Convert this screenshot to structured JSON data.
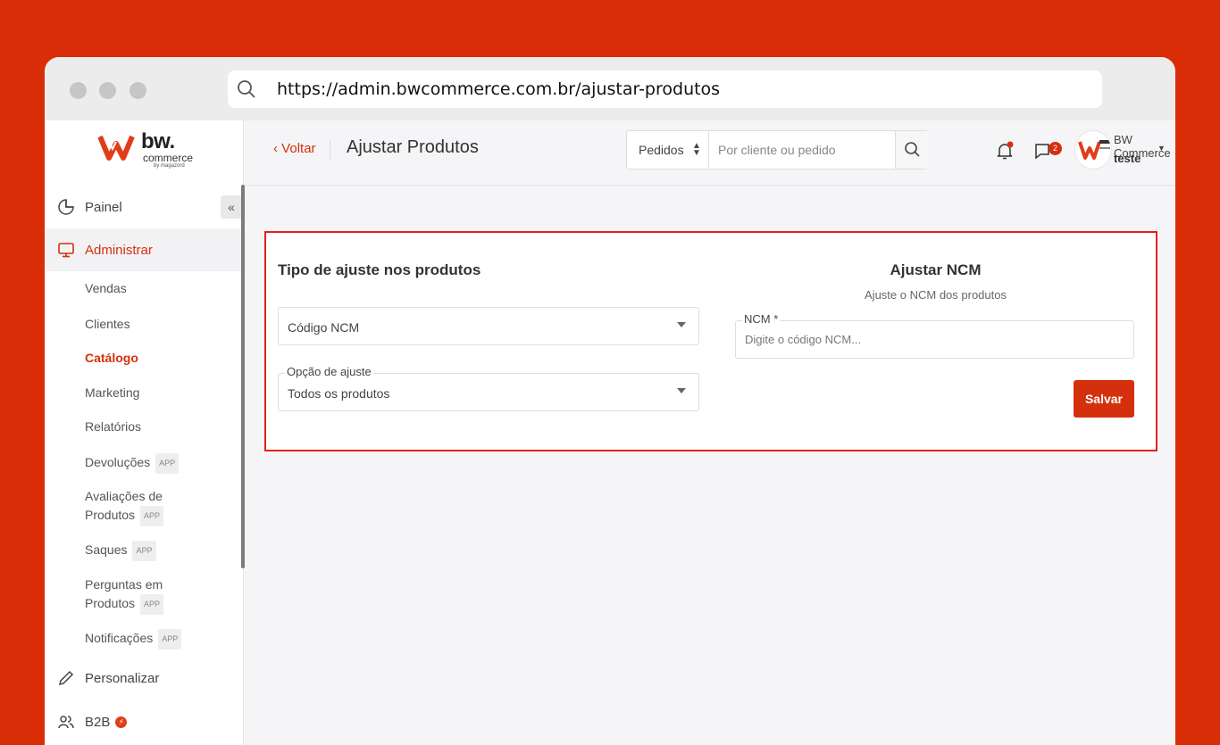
{
  "browser": {
    "url": "https://admin.bwcommerce.com.br/ajustar-produtos"
  },
  "logo": {
    "brand": "bw.",
    "sub": "commerce",
    "by": "by magazord",
    "accent_color": "#e23c18"
  },
  "sidebar": {
    "main_items": [
      {
        "label": "Painel",
        "icon": "pie-chart-icon"
      },
      {
        "label": "Administrar",
        "icon": "monitor-icon"
      },
      {
        "label": "Personalizar",
        "icon": "pencil-icon"
      },
      {
        "label": "B2B",
        "icon": "users-icon"
      }
    ],
    "sub_items": [
      {
        "label": "Vendas"
      },
      {
        "label": "Clientes"
      },
      {
        "label": "Catálogo"
      },
      {
        "label": "Marketing"
      },
      {
        "label": "Relatórios"
      },
      {
        "label": "Devoluções",
        "badge": "APP"
      },
      {
        "label": "Avaliações de",
        "label2": "Produtos",
        "badge": "APP"
      },
      {
        "label": "Saques",
        "badge": "APP"
      },
      {
        "label": "Perguntas em",
        "label2": "Produtos",
        "badge": "APP"
      },
      {
        "label": "Notificações",
        "badge": "APP"
      }
    ],
    "collapse_glyph": "«"
  },
  "header": {
    "back_label": "Voltar",
    "title": "Ajustar Produtos",
    "search_type": "Pedidos",
    "search_placeholder": "Por cliente ou pedido",
    "chat_count": "2",
    "user_name": "BW Commerce",
    "user_role": "teste"
  },
  "card": {
    "left_title": "Tipo de ajuste nos produtos",
    "adjust_type_value": "Código NCM",
    "option_label": "Opção de ajuste",
    "option_value": "Todos os produtos",
    "right_title": "Ajustar NCM",
    "right_subtitle": "Ajuste o NCM dos produtos",
    "ncm_label": "NCM *",
    "ncm_placeholder": "Digite o código NCM...",
    "save_label": "Salvar"
  },
  "colors": {
    "background": "#d92d07",
    "accent": "#d5300d",
    "card_border": "#e32020"
  }
}
